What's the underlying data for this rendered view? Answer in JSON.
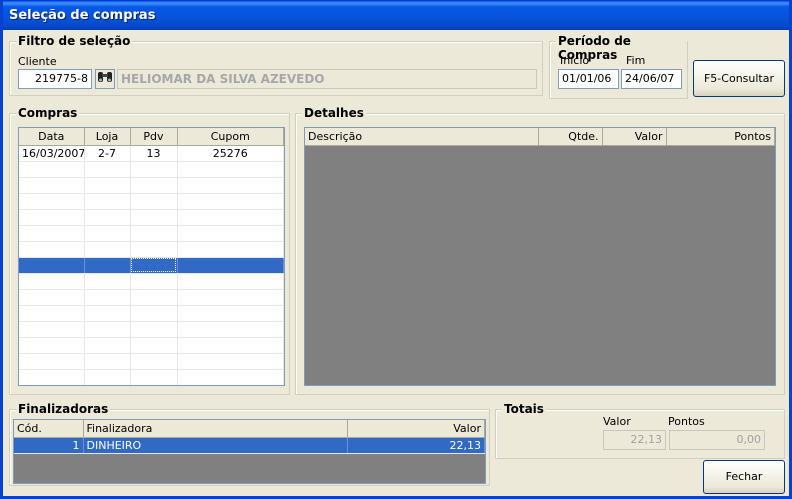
{
  "window": {
    "title": "Seleção de compras",
    "close_glyph": "×"
  },
  "filtro": {
    "title": "Filtro de seleção",
    "cliente_label": "Cliente",
    "cliente_code": "219775-8",
    "cliente_name": "HELIOMAR DA SILVA AZEVEDO",
    "search_icon": "binoculars-icon"
  },
  "periodo": {
    "title": "Período de Compras",
    "inicio_label": "Início",
    "fim_label": "Fim",
    "inicio_value": "01/01/06",
    "fim_value": "24/06/07"
  },
  "consultar_label": "F5-Consultar",
  "compras": {
    "title": "Compras",
    "columns": [
      "Data",
      "Loja",
      "Pdv",
      "Cupom"
    ],
    "rows": [
      [
        "16/03/2007",
        "2-7",
        "13",
        "25276"
      ]
    ]
  },
  "detalhes": {
    "title": "Detalhes",
    "columns": [
      "Descrição",
      "Qtde.",
      "Valor",
      "Pontos"
    ]
  },
  "finalizadoras": {
    "title": "Finalizadoras",
    "columns": [
      "Cód.",
      "Finalizadora",
      "Valor"
    ],
    "rows": [
      [
        "1",
        "DINHEIRO",
        "22,13"
      ]
    ]
  },
  "totais": {
    "title": "Totais",
    "valor_label": "Valor",
    "pontos_label": "Pontos",
    "valor": "22,13",
    "pontos": "0,00"
  },
  "fechar_label": "Fechar",
  "colors": {
    "selection": "#316ac5",
    "titlebar": "#0653d8",
    "empty_grid": "#808080"
  }
}
